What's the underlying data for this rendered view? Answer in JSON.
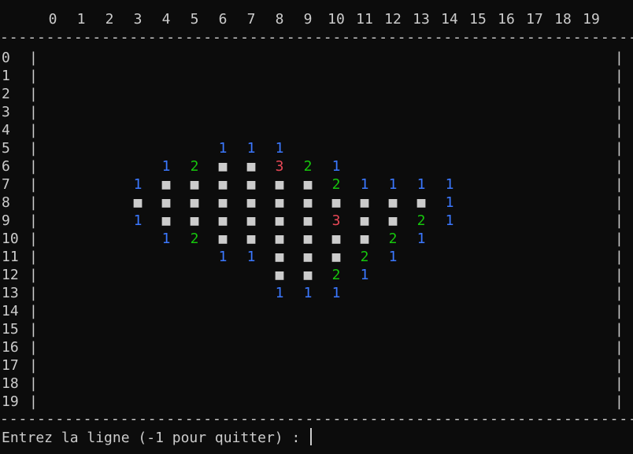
{
  "header": {
    "columns": [
      "0",
      "1",
      "2",
      "3",
      "4",
      "5",
      "6",
      "7",
      "8",
      "9",
      "10",
      "11",
      "12",
      "13",
      "14",
      "15",
      "16",
      "17",
      "18",
      "19"
    ]
  },
  "board": {
    "row_labels": [
      "0",
      "1",
      "2",
      "3",
      "4",
      "5",
      "6",
      "7",
      "8",
      "9",
      "10",
      "11",
      "12",
      "13",
      "14",
      "15",
      "16",
      "17",
      "18",
      "19"
    ],
    "border_char": "|",
    "separator_text": "--------------------------------------------------------------------------------------------",
    "cells": [
      {
        "row": 5,
        "col": 6,
        "value": "1"
      },
      {
        "row": 5,
        "col": 7,
        "value": "1"
      },
      {
        "row": 5,
        "col": 8,
        "value": "1"
      },
      {
        "row": 6,
        "col": 4,
        "value": "1"
      },
      {
        "row": 6,
        "col": 5,
        "value": "2"
      },
      {
        "row": 6,
        "col": 6,
        "value": "■"
      },
      {
        "row": 6,
        "col": 7,
        "value": "■"
      },
      {
        "row": 6,
        "col": 8,
        "value": "3"
      },
      {
        "row": 6,
        "col": 9,
        "value": "2"
      },
      {
        "row": 6,
        "col": 10,
        "value": "1"
      },
      {
        "row": 7,
        "col": 3,
        "value": "1"
      },
      {
        "row": 7,
        "col": 4,
        "value": "■"
      },
      {
        "row": 7,
        "col": 5,
        "value": "■"
      },
      {
        "row": 7,
        "col": 6,
        "value": "■"
      },
      {
        "row": 7,
        "col": 7,
        "value": "■"
      },
      {
        "row": 7,
        "col": 8,
        "value": "■"
      },
      {
        "row": 7,
        "col": 9,
        "value": "■"
      },
      {
        "row": 7,
        "col": 10,
        "value": "2"
      },
      {
        "row": 7,
        "col": 11,
        "value": "1"
      },
      {
        "row": 7,
        "col": 12,
        "value": "1"
      },
      {
        "row": 7,
        "col": 13,
        "value": "1"
      },
      {
        "row": 7,
        "col": 14,
        "value": "1"
      },
      {
        "row": 8,
        "col": 3,
        "value": "■"
      },
      {
        "row": 8,
        "col": 4,
        "value": "■"
      },
      {
        "row": 8,
        "col": 5,
        "value": "■"
      },
      {
        "row": 8,
        "col": 6,
        "value": "■"
      },
      {
        "row": 8,
        "col": 7,
        "value": "■"
      },
      {
        "row": 8,
        "col": 8,
        "value": "■"
      },
      {
        "row": 8,
        "col": 9,
        "value": "■"
      },
      {
        "row": 8,
        "col": 10,
        "value": "■"
      },
      {
        "row": 8,
        "col": 11,
        "value": "■"
      },
      {
        "row": 8,
        "col": 12,
        "value": "■"
      },
      {
        "row": 8,
        "col": 13,
        "value": "■"
      },
      {
        "row": 8,
        "col": 14,
        "value": "1"
      },
      {
        "row": 9,
        "col": 3,
        "value": "1"
      },
      {
        "row": 9,
        "col": 4,
        "value": "■"
      },
      {
        "row": 9,
        "col": 5,
        "value": "■"
      },
      {
        "row": 9,
        "col": 6,
        "value": "■"
      },
      {
        "row": 9,
        "col": 7,
        "value": "■"
      },
      {
        "row": 9,
        "col": 8,
        "value": "■"
      },
      {
        "row": 9,
        "col": 9,
        "value": "■"
      },
      {
        "row": 9,
        "col": 10,
        "value": "3"
      },
      {
        "row": 9,
        "col": 11,
        "value": "■"
      },
      {
        "row": 9,
        "col": 12,
        "value": "■"
      },
      {
        "row": 9,
        "col": 13,
        "value": "2"
      },
      {
        "row": 9,
        "col": 14,
        "value": "1"
      },
      {
        "row": 10,
        "col": 4,
        "value": "1"
      },
      {
        "row": 10,
        "col": 5,
        "value": "2"
      },
      {
        "row": 10,
        "col": 6,
        "value": "■"
      },
      {
        "row": 10,
        "col": 7,
        "value": "■"
      },
      {
        "row": 10,
        "col": 8,
        "value": "■"
      },
      {
        "row": 10,
        "col": 9,
        "value": "■"
      },
      {
        "row": 10,
        "col": 10,
        "value": "■"
      },
      {
        "row": 10,
        "col": 11,
        "value": "■"
      },
      {
        "row": 10,
        "col": 12,
        "value": "2"
      },
      {
        "row": 10,
        "col": 13,
        "value": "1"
      },
      {
        "row": 11,
        "col": 6,
        "value": "1"
      },
      {
        "row": 11,
        "col": 7,
        "value": "1"
      },
      {
        "row": 11,
        "col": 8,
        "value": "■"
      },
      {
        "row": 11,
        "col": 9,
        "value": "■"
      },
      {
        "row": 11,
        "col": 10,
        "value": "■"
      },
      {
        "row": 11,
        "col": 11,
        "value": "2"
      },
      {
        "row": 11,
        "col": 12,
        "value": "1"
      },
      {
        "row": 12,
        "col": 8,
        "value": "■"
      },
      {
        "row": 12,
        "col": 9,
        "value": "■"
      },
      {
        "row": 12,
        "col": 10,
        "value": "2"
      },
      {
        "row": 12,
        "col": 11,
        "value": "1"
      },
      {
        "row": 13,
        "col": 8,
        "value": "1"
      },
      {
        "row": 13,
        "col": 9,
        "value": "1"
      },
      {
        "row": 13,
        "col": 10,
        "value": "1"
      }
    ]
  },
  "prompt": {
    "text": "Entrez la ligne (-1 pour quitter) : "
  },
  "colors": {
    "background": "#0c0c0c",
    "foreground": "#cccccc",
    "one": "#3b78ff",
    "two": "#16c60c",
    "three": "#e74856"
  }
}
